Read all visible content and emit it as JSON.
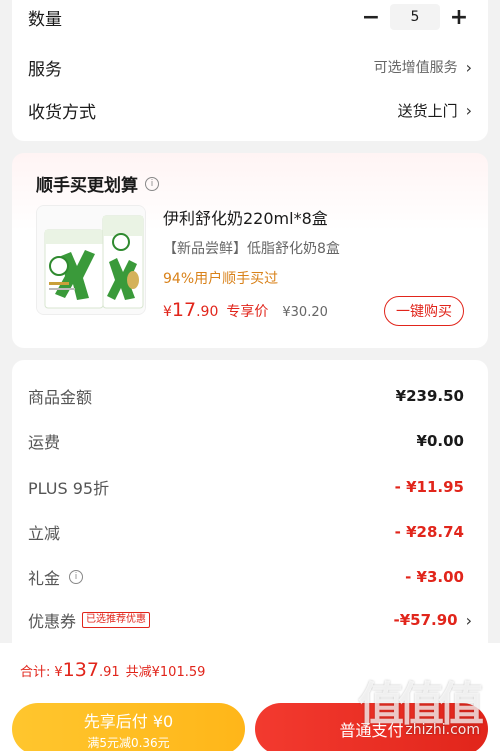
{
  "order": {
    "quantity_label": "数量",
    "quantity_value": "5",
    "minus": "−",
    "plus": "+",
    "service_label": "服务",
    "service_value": "可选增值服务",
    "delivery_label": "收货方式",
    "delivery_value": "送货上门",
    "chevron": "›"
  },
  "recommend": {
    "title": "顺手买更划算",
    "info": "i",
    "product_name": "伊利舒化奶220ml*8盒",
    "product_sub": "【新品尝鲜】低脂舒化奶8盒",
    "product_hot": "94%用户顺手买过",
    "price_symbol": "¥",
    "price_int": "17",
    "price_dec": ".90",
    "price_tag": "专享价",
    "orig_price": "¥30.20",
    "buy_label": "一键购买"
  },
  "summary": {
    "rows": [
      {
        "label": "商品金额",
        "value": "¥239.50",
        "red": false
      },
      {
        "label": "运费",
        "value": "¥0.00",
        "red": false
      },
      {
        "label": "PLUS 95折",
        "value": "- ¥11.95",
        "red": true
      },
      {
        "label": "立减",
        "value": "- ¥28.74",
        "red": true
      },
      {
        "label": "礼金",
        "value": "- ¥3.00",
        "red": true
      },
      {
        "label": "优惠券",
        "value": "-¥57.90",
        "red": true
      }
    ],
    "coupon_tag": "已选推荐优惠"
  },
  "bottom": {
    "total_label": "合计:",
    "total_symbol": "¥",
    "total_int": "137",
    "total_dec": ".91",
    "save_text": "共减¥101.59",
    "pay_later_label": "先享后付 ¥0",
    "pay_later_sub": "满5元减0.36元",
    "pay_normal_label": "普通支付"
  },
  "watermark": {
    "chars": "值值值",
    "url": "zhizhi.com"
  },
  "colors": {
    "accent_red": "#e1251b",
    "hot_orange": "#d9821a",
    "pay_yellow": "#ffc62e"
  }
}
